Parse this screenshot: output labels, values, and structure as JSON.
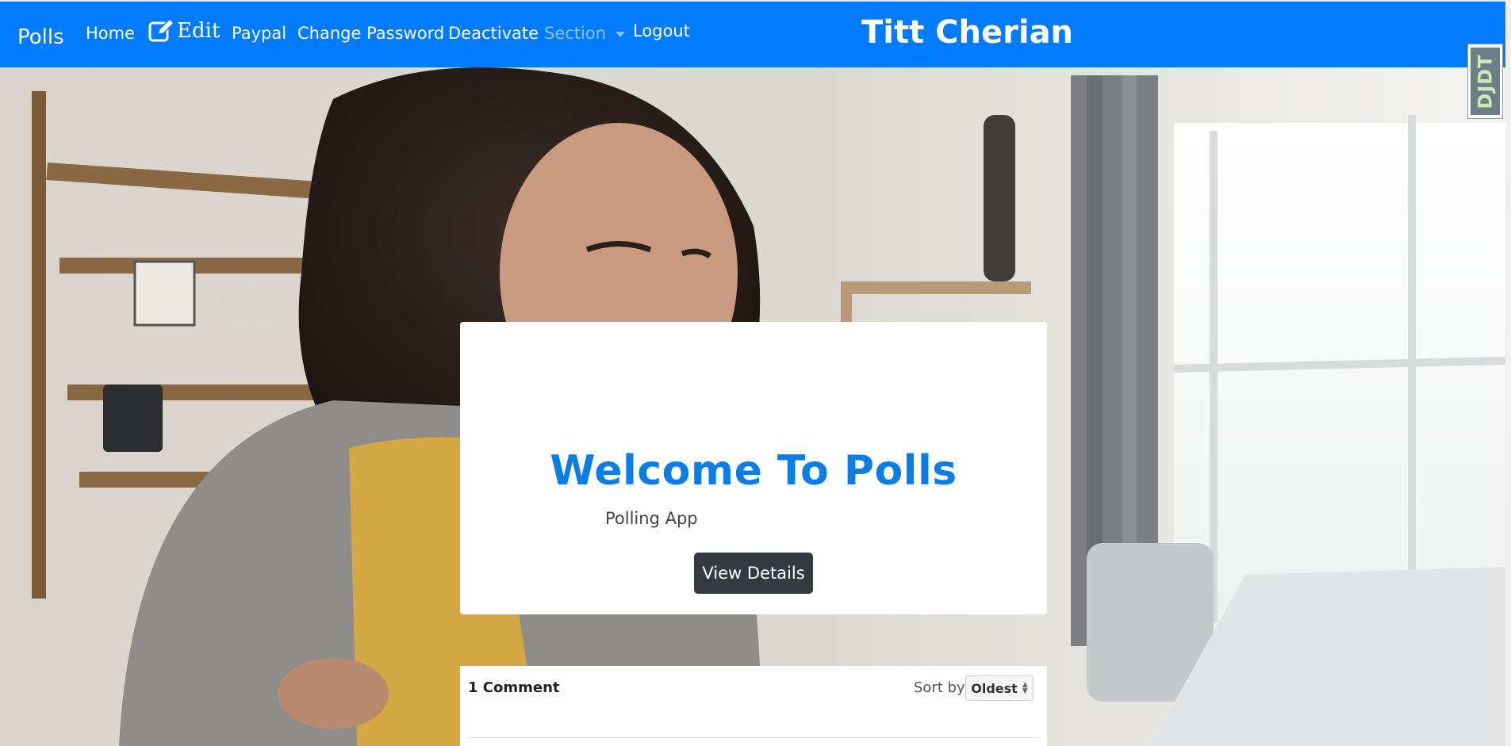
{
  "navbar": {
    "brand": "Polls",
    "items": [
      {
        "label": "Home",
        "icon": "home"
      },
      {
        "label": "Edit",
        "icon": "edit-icon"
      },
      {
        "label": "Paypal"
      },
      {
        "label": "Change Password"
      },
      {
        "label": "Deactivate"
      },
      {
        "label": "Section",
        "icon": "chevron-down-icon"
      },
      {
        "label": "Logout"
      }
    ],
    "site_title": "Titt Cherian"
  },
  "card": {
    "heading": "Welcome To Polls",
    "subheading": "Polling App",
    "button_label": "View Details"
  },
  "comments": {
    "count_label": "1 Comment",
    "sort_label": "Sort by",
    "sort_value": "Oldest"
  },
  "debug_toolbar": {
    "label": "DJDT"
  },
  "colors": {
    "navbar_bg": "#007bff",
    "heading": "#0d7de6",
    "button_bg": "#343a40"
  }
}
